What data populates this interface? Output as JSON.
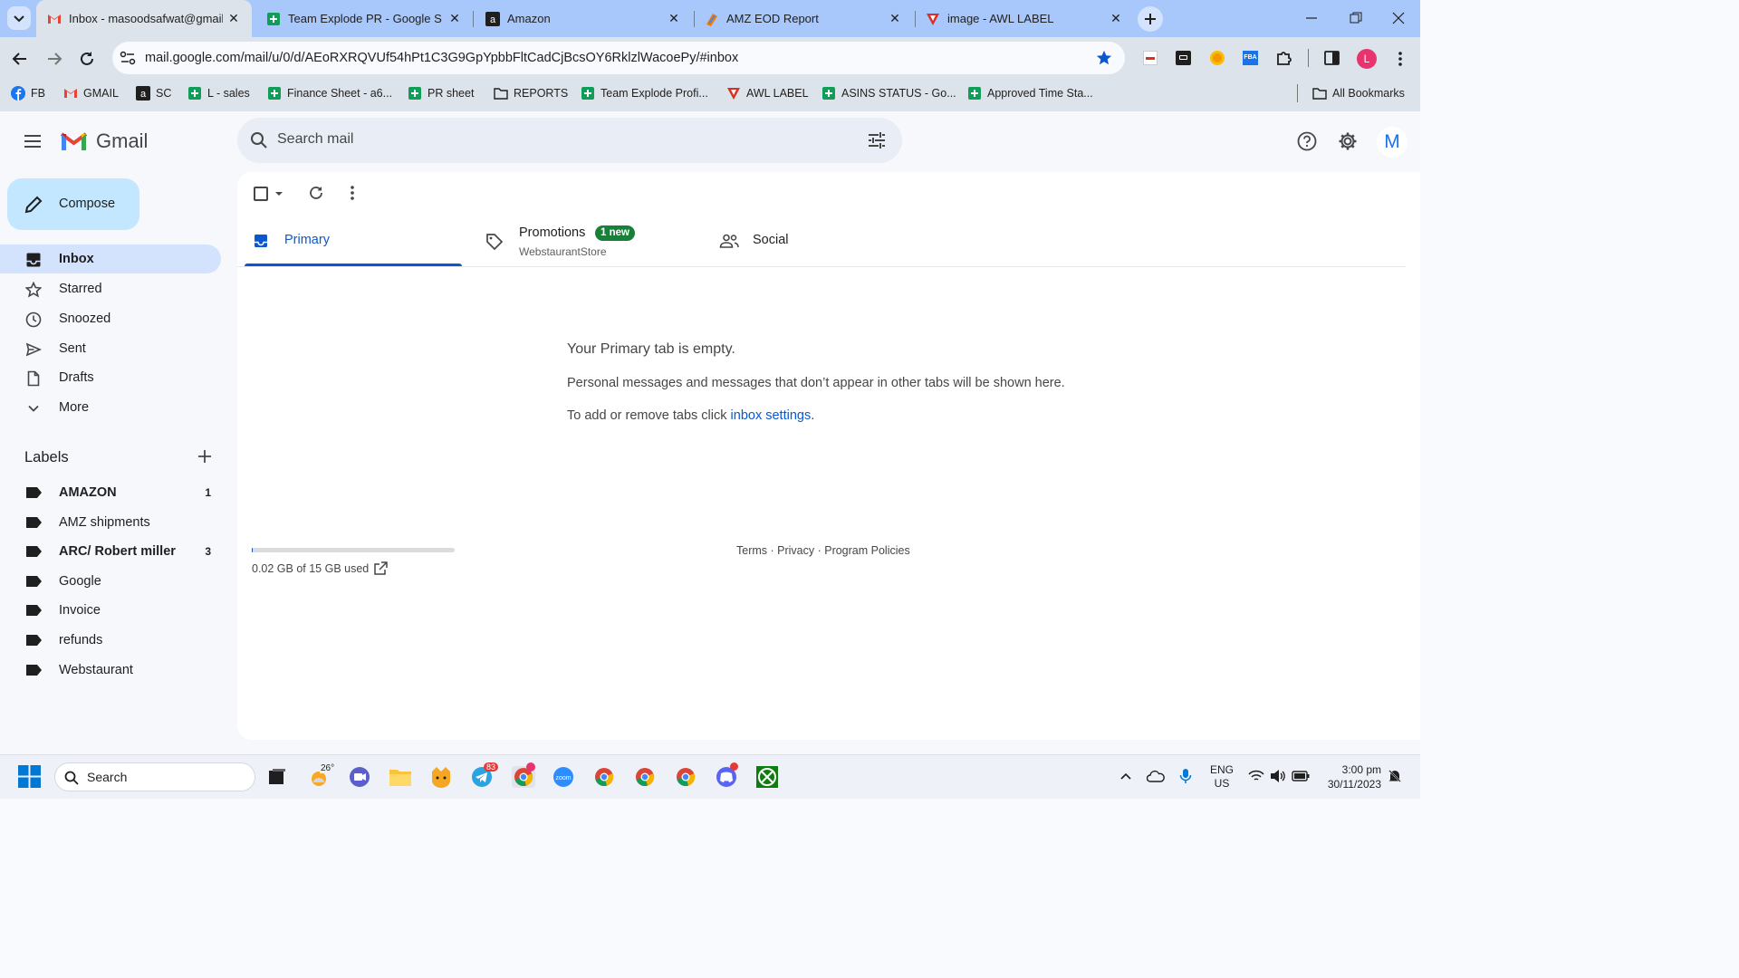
{
  "browser": {
    "tabs": [
      {
        "title": "Inbox - masoodsafwat@gmail.",
        "active": true
      },
      {
        "title": "Team Explode PR - Google She"
      },
      {
        "title": "Amazon"
      },
      {
        "title": "AMZ EOD Report"
      },
      {
        "title": "image - AWL LABEL"
      }
    ],
    "url": "mail.google.com/mail/u/0/d/AEoRXRQVUf54hPt1C3G9GpYpbbFltCadCjBcsOY6RklzlWacoePy/#inbox",
    "profile_letter": "L",
    "bookmarks": [
      {
        "label": "FB"
      },
      {
        "label": "GMAIL"
      },
      {
        "label": "SC"
      },
      {
        "label": "L - sales"
      },
      {
        "label": "Finance Sheet - a6..."
      },
      {
        "label": "PR sheet"
      },
      {
        "label": "REPORTS"
      },
      {
        "label": "Team Explode Profi..."
      },
      {
        "label": "AWL LABEL"
      },
      {
        "label": "ASINS STATUS - Go..."
      },
      {
        "label": "Approved Time Sta..."
      }
    ],
    "all_bookmarks": "All Bookmarks"
  },
  "gmail": {
    "logo_text": "Gmail",
    "search_placeholder": "Search mail",
    "account_letter": "M",
    "compose": "Compose",
    "nav": [
      {
        "label": "Inbox"
      },
      {
        "label": "Starred"
      },
      {
        "label": "Snoozed"
      },
      {
        "label": "Sent"
      },
      {
        "label": "Drafts"
      },
      {
        "label": "More"
      }
    ],
    "labels_heading": "Labels",
    "labels": [
      {
        "name": "AMAZON",
        "count": "1"
      },
      {
        "name": "AMZ shipments",
        "count": ""
      },
      {
        "name": "ARC/ Robert miller",
        "count": "3"
      },
      {
        "name": "Google",
        "count": ""
      },
      {
        "name": "Invoice",
        "count": ""
      },
      {
        "name": "refunds",
        "count": ""
      },
      {
        "name": "Webstaurant",
        "count": ""
      }
    ],
    "tabs": {
      "primary": "Primary",
      "promotions": "Promotions",
      "promotions_badge": "1 new",
      "promotions_sub": "WebstaurantStore",
      "social": "Social"
    },
    "empty": {
      "title": "Your Primary tab is empty.",
      "line1": "Personal messages and messages that don’t appear in other tabs will be shown here.",
      "line2_prefix": "To add or remove tabs click ",
      "line2_link": "inbox settings",
      "line2_suffix": "."
    },
    "storage": {
      "text": "0.02 GB of 15 GB used",
      "fraction": 0.0013
    },
    "footer": {
      "terms": "Terms",
      "sep": " · ",
      "privacy": "Privacy",
      "policies": "Program Policies"
    }
  },
  "taskbar": {
    "search": "Search",
    "weather": "26°",
    "telegram_badge": "83",
    "lang": "ENG",
    "region": "US",
    "time": "3:00 pm",
    "date": "30/11/2023"
  },
  "colors": {
    "accent": "#0b57d0",
    "compose_bg": "#c2e7ff",
    "active_nav": "#d3e3fd",
    "badge_green": "#188038"
  }
}
